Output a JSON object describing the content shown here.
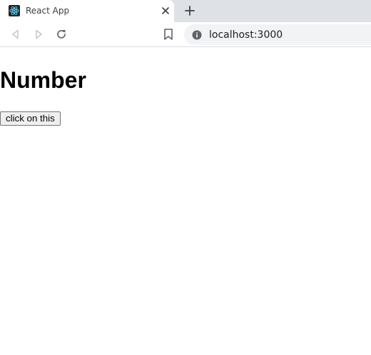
{
  "browser": {
    "tab": {
      "title": "React App",
      "favicon": "react-logo-icon"
    },
    "new_tab_icon": "plus-icon",
    "toolbar": {
      "back_icon": "back-arrow-icon",
      "forward_icon": "forward-arrow-icon",
      "reload_icon": "reload-icon",
      "bookmark_icon": "bookmark-icon",
      "site_info_icon": "info-icon",
      "url": "localhost:3000"
    }
  },
  "page": {
    "heading": "Number",
    "button_label": "click on this"
  },
  "colors": {
    "tabstrip_bg": "#dee1e6",
    "omnibox_bg": "#f1f3f4",
    "react_blue": "#61dafb"
  }
}
